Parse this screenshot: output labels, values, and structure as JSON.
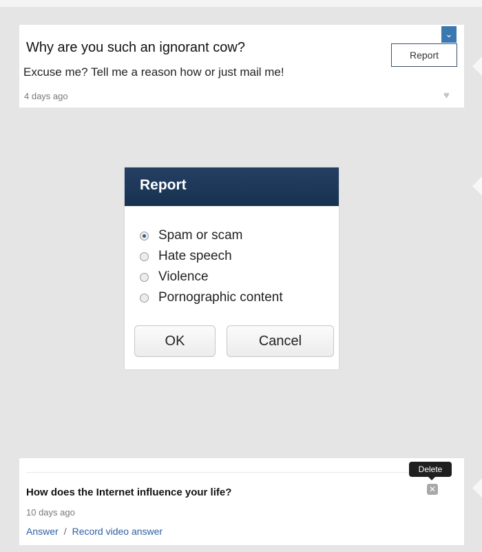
{
  "question1": {
    "text": "Why are you such an ignorant cow?",
    "answer": "Excuse me? Tell me a reason how or just mail me!",
    "time": "4 days ago",
    "dropdown_icon": "chevron-down-icon",
    "menu_report_label": "Report"
  },
  "dialog": {
    "title": "Report",
    "options": [
      {
        "label": "Spam or scam",
        "selected": true
      },
      {
        "label": "Hate speech",
        "selected": false
      },
      {
        "label": "Violence",
        "selected": false
      },
      {
        "label": "Pornographic content",
        "selected": false
      }
    ],
    "ok_label": "OK",
    "cancel_label": "Cancel"
  },
  "question2": {
    "text": "How does the Internet influence your life?",
    "time": "10 days ago",
    "answer_link": "Answer",
    "separator": "/",
    "video_link": "Record video answer",
    "delete_tooltip": "Delete"
  },
  "colors": {
    "background": "#e5e5e5",
    "card": "#ffffff",
    "dialog_header": "#1c3656",
    "accent_blue": "#3a79b0",
    "link": "#2b5ea6"
  }
}
